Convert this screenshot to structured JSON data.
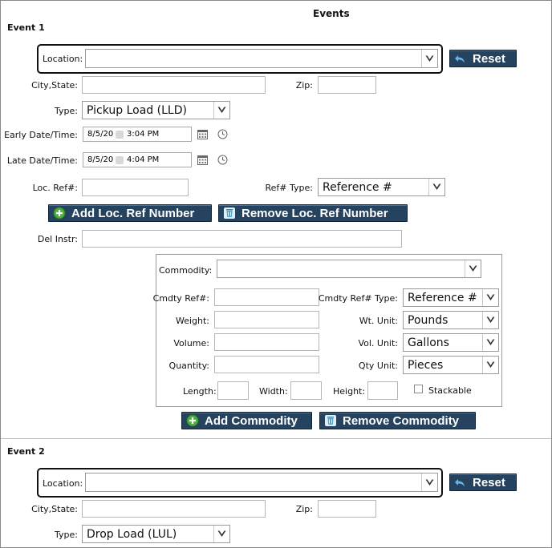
{
  "header": {
    "title": "Events"
  },
  "event1": {
    "title": "Event 1",
    "location_label": "Location:",
    "location_value": "",
    "reset_label": "Reset",
    "city_label": "City,State:",
    "zip_label": "Zip:",
    "type_label": "Type:",
    "type_value": "Pickup Load (LLD)",
    "early_label": "Early Date/Time:",
    "early_date": "8/5/20",
    "early_time": "3:04 PM",
    "late_label": "Late Date/Time:",
    "late_date": "8/5/20",
    "late_time": "4:04 PM",
    "locref_label": "Loc. Ref#:",
    "reftype_label": "Ref# Type:",
    "reftype_value": "Reference #",
    "add_locref_label": "Add Loc. Ref Number",
    "remove_locref_label": "Remove Loc. Ref Number",
    "delinstr_label": "Del Instr:",
    "commodity": {
      "commodity_label": "Commodity:",
      "cmdty_ref_label": "Cmdty Ref#:",
      "cmdty_reftype_label": "Cmdty Ref# Type:",
      "cmdty_reftype_value": "Reference #",
      "weight_label": "Weight:",
      "wt_unit_label": "Wt. Unit:",
      "wt_unit_value": "Pounds",
      "volume_label": "Volume:",
      "vol_unit_label": "Vol. Unit:",
      "vol_unit_value": "Gallons",
      "quantity_label": "Quantity:",
      "qty_unit_label": "Qty Unit:",
      "qty_unit_value": "Pieces",
      "length_label": "Length:",
      "width_label": "Width:",
      "height_label": "Height:",
      "stackable_label": "Stackable",
      "stackable_checked": false
    },
    "add_commodity_label": "Add Commodity",
    "remove_commodity_label": "Remove Commodity"
  },
  "event2": {
    "title": "Event 2",
    "location_label": "Location:",
    "reset_label": "Reset",
    "city_label": "City,State:",
    "zip_label": "Zip:",
    "type_label": "Type:",
    "type_value": "Drop Load (LUL)"
  },
  "colors": {
    "button_bg": "#25425e",
    "add_icon": "#4caf3e",
    "remove_icon": "#5aa6c8"
  },
  "icons": [
    "chevron-down-icon",
    "undo-icon",
    "calendar-icon",
    "clock-icon",
    "plus-circle-icon",
    "trash-icon"
  ]
}
